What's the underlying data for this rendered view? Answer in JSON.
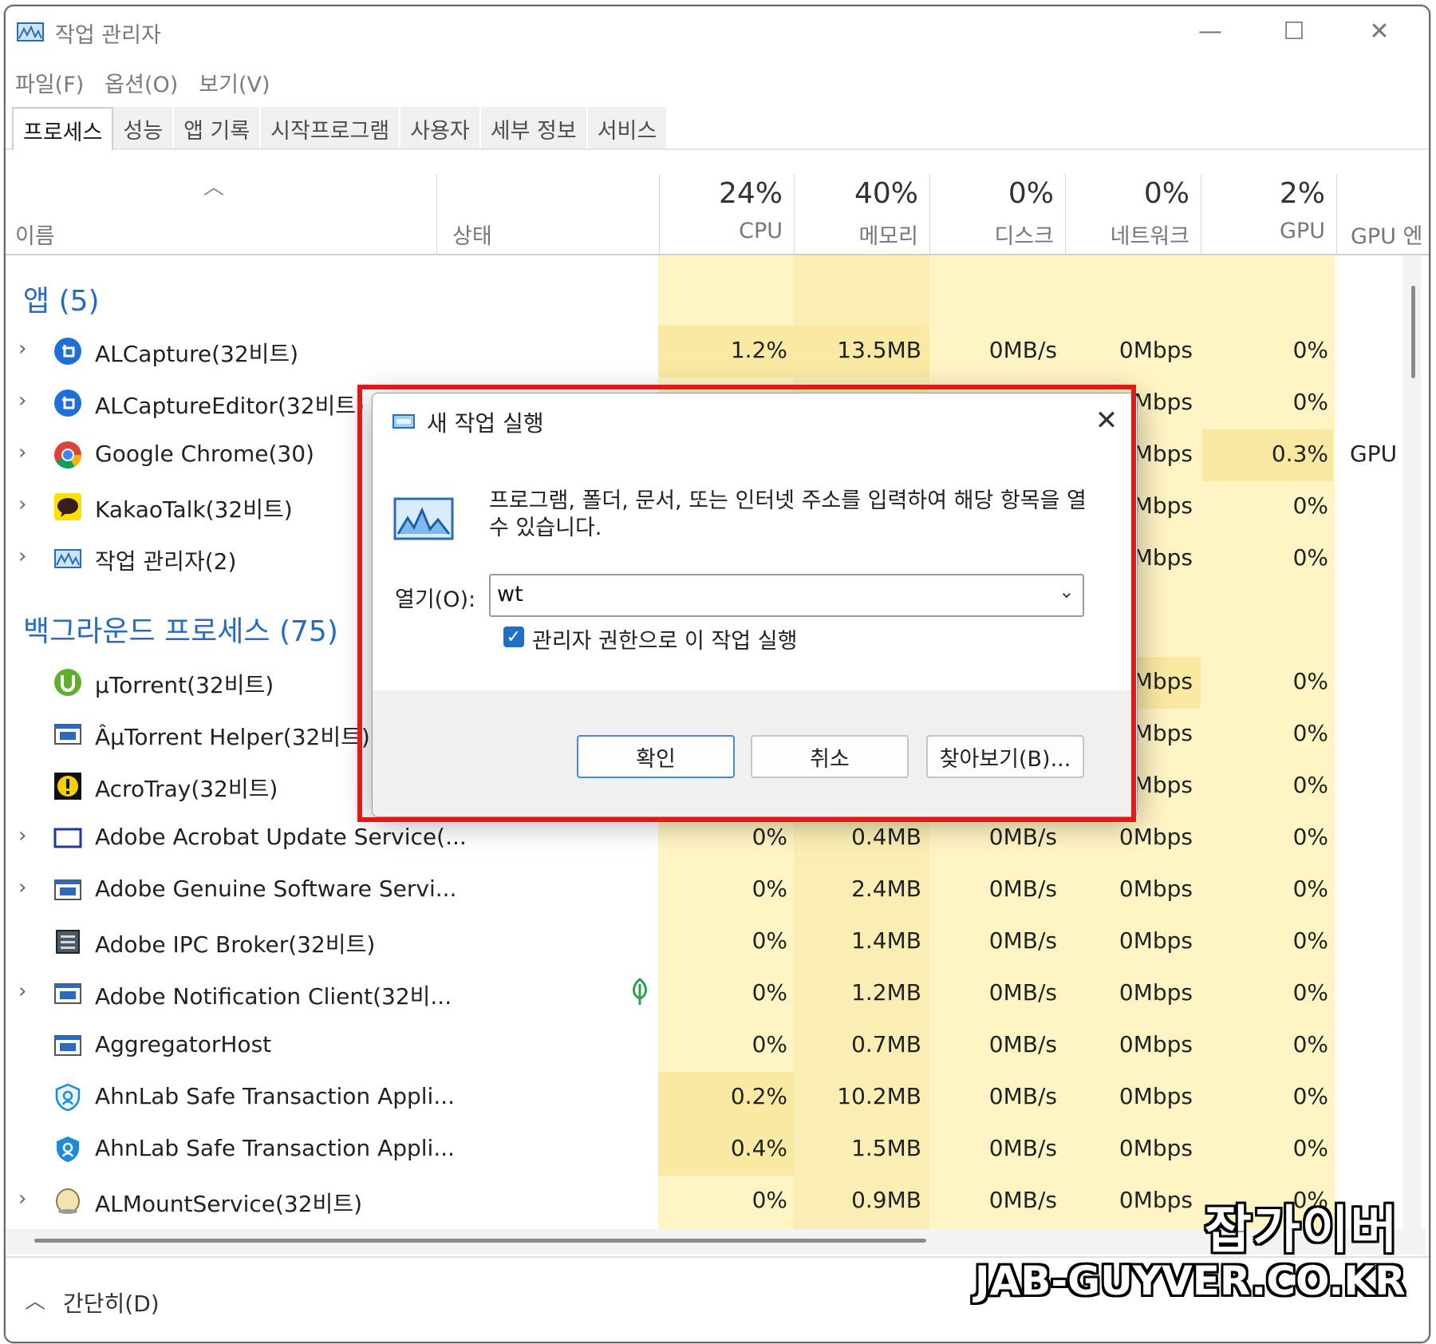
{
  "window": {
    "title": "작업 관리자",
    "minimize": "—",
    "maximize": "☐",
    "close": "✕"
  },
  "menu": [
    "파일(F)",
    "옵션(O)",
    "보기(V)"
  ],
  "tabs": [
    "프로세스",
    "성능",
    "앱 기록",
    "시작프로그램",
    "사용자",
    "세부 정보",
    "서비스"
  ],
  "columns": {
    "name": "이름",
    "status": "상태",
    "cpu": {
      "pct": "24%",
      "label": "CPU"
    },
    "memory": {
      "pct": "40%",
      "label": "메모리"
    },
    "disk": {
      "pct": "0%",
      "label": "디스크"
    },
    "network": {
      "pct": "0%",
      "label": "네트워크"
    },
    "gpu": {
      "pct": "2%",
      "label": "GPU"
    },
    "gpu_engine": {
      "label": "GPU 엔"
    }
  },
  "groups": {
    "apps": "앱 (5)",
    "background": "백그라운드 프로세스 (75)"
  },
  "apps": [
    {
      "name": "ALCapture(32비트)",
      "cpu": "1.2%",
      "mem": "13.5MB",
      "disk": "0MB/s",
      "net": "0Mbps",
      "gpu": "0%",
      "gpue": "",
      "icon": "alcapture-icon"
    },
    {
      "name": "ALCaptureEditor(32비트)",
      "cpu": "",
      "mem": "",
      "disk": "",
      "net": "Mbps",
      "gpu": "0%",
      "gpue": "",
      "icon": "alcapture-editor-icon"
    },
    {
      "name": "Google Chrome(30)",
      "cpu": "",
      "mem": "",
      "disk": "",
      "net": "Mbps",
      "gpu": "0.3%",
      "gpue": "GPU",
      "icon": "chrome-icon"
    },
    {
      "name": "KakaoTalk(32비트)",
      "cpu": "",
      "mem": "",
      "disk": "",
      "net": "Mbps",
      "gpu": "0%",
      "gpue": "",
      "icon": "kakaotalk-icon"
    },
    {
      "name": "작업 관리자(2)",
      "cpu": "",
      "mem": "",
      "disk": "",
      "net": "Mbps",
      "gpu": "0%",
      "gpue": "",
      "icon": "task-manager-icon"
    }
  ],
  "background": [
    {
      "name": "µTorrent(32비트)",
      "cpu": "",
      "mem": "",
      "disk": "",
      "net": "Mbps",
      "gpu": "0%",
      "icon": "utorrent-icon"
    },
    {
      "name": "ÂµTorrent Helper(32비트)",
      "cpu": "",
      "mem": "",
      "disk": "",
      "net": "Mbps",
      "gpu": "0%",
      "icon": "window-icon"
    },
    {
      "name": "AcroTray(32비트)",
      "cpu": "",
      "mem": "",
      "disk": "",
      "net": "Mbps",
      "gpu": "0%",
      "icon": "acrotray-icon"
    },
    {
      "name": "Adobe Acrobat Update Service(...",
      "cpu": "0%",
      "mem": "0.4MB",
      "disk": "0MB/s",
      "net": "0Mbps",
      "gpu": "0%",
      "icon": "window-outline-icon"
    },
    {
      "name": "Adobe Genuine Software Servi...",
      "cpu": "0%",
      "mem": "2.4MB",
      "disk": "0MB/s",
      "net": "0Mbps",
      "gpu": "0%",
      "icon": "window-icon"
    },
    {
      "name": "Adobe IPC Broker(32비트)",
      "cpu": "0%",
      "mem": "1.4MB",
      "disk": "0MB/s",
      "net": "0Mbps",
      "gpu": "0%",
      "icon": "ipc-broker-icon"
    },
    {
      "name": "Adobe Notification Client(32비...",
      "cpu": "0%",
      "mem": "1.2MB",
      "disk": "0MB/s",
      "net": "0Mbps",
      "gpu": "0%",
      "icon": "window-icon"
    },
    {
      "name": "AggregatorHost",
      "cpu": "0%",
      "mem": "0.7MB",
      "disk": "0MB/s",
      "net": "0Mbps",
      "gpu": "0%",
      "icon": "window-icon"
    },
    {
      "name": "AhnLab Safe Transaction Appli...",
      "cpu": "0.2%",
      "mem": "10.2MB",
      "disk": "0MB/s",
      "net": "0Mbps",
      "gpu": "0%",
      "icon": "shield-icon"
    },
    {
      "name": "AhnLab Safe Transaction Appli...",
      "cpu": "0.4%",
      "mem": "1.5MB",
      "disk": "0MB/s",
      "net": "0Mbps",
      "gpu": "0%",
      "icon": "shield-icon"
    },
    {
      "name": "ALMountService(32비트)",
      "cpu": "0%",
      "mem": "0.9MB",
      "disk": "0MB/s",
      "net": "0Mbps",
      "gpu": "0%",
      "icon": "almount-icon"
    }
  ],
  "footer": {
    "toggle": "간단히(D)"
  },
  "dialog": {
    "title": "새 작업 실행",
    "close": "✕",
    "description": "프로그램, 폴더, 문서, 또는 인터넷 주소를 입력하여 해당 항목을 열 수 있습니다.",
    "open_label": "열기(O):",
    "open_value": "wt",
    "admin_checkbox": "관리자 권한으로 이 작업 실행",
    "admin_checked": true,
    "ok": "확인",
    "cancel": "취소",
    "browse": "찾아보기(B)..."
  },
  "watermark": {
    "line1": "잡가이버",
    "line2": "JAB-GUYVER.CO.KR"
  },
  "colors": {
    "accent": "#2a6bbf",
    "highlight_border": "#e01919",
    "column_shade": "#fff4c4",
    "column_strong": "#f9e9a3"
  }
}
